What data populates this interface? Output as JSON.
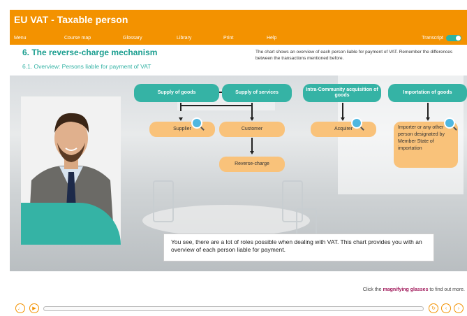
{
  "header": {
    "title": "EU VAT - Taxable person",
    "menu": [
      "Menu",
      "Course map",
      "Glossary",
      "Library",
      "Print",
      "Help"
    ],
    "transcript_label": "Transcript"
  },
  "content": {
    "section_title": "6. The reverse-charge mechanism",
    "subsection_title": "6.1. Overview: Persons liable for payment of VAT",
    "intro_text": "The chart shows an overview of each person liable for payment of VAT. Remember the differences between the transactions mentioned before."
  },
  "diagram": {
    "supply_goods": "Supply of goods",
    "supply_services": "Supply of services",
    "intra_community": "Intra-Community acquisition of goods",
    "importation": "Importation of goods",
    "supplier": "Supplier",
    "customer": "Customer",
    "reverse_charge": "Reverse-charge",
    "acquirer": "Acquirer",
    "importer": "Importer or any other person designated by Member State of importation"
  },
  "speech": "You see, there are a lot of roles possible when dealing with VAT. This chart provides you with an overview of each person liable for payment.",
  "hint": {
    "prefix": "Click the ",
    "bold": "magnifying glasses",
    "suffix": " to find out more."
  },
  "icons": {
    "magnify": "magnifying-glass-icon",
    "audio": "speaker-icon",
    "play": "play-icon",
    "replay": "replay-icon",
    "prev": "chevron-left-icon",
    "next": "chevron-right-icon"
  },
  "colors": {
    "brand_orange": "#f39200",
    "teal": "#35b3a5",
    "light_orange": "#f9c27a",
    "hint_bold": "#a0185a"
  }
}
